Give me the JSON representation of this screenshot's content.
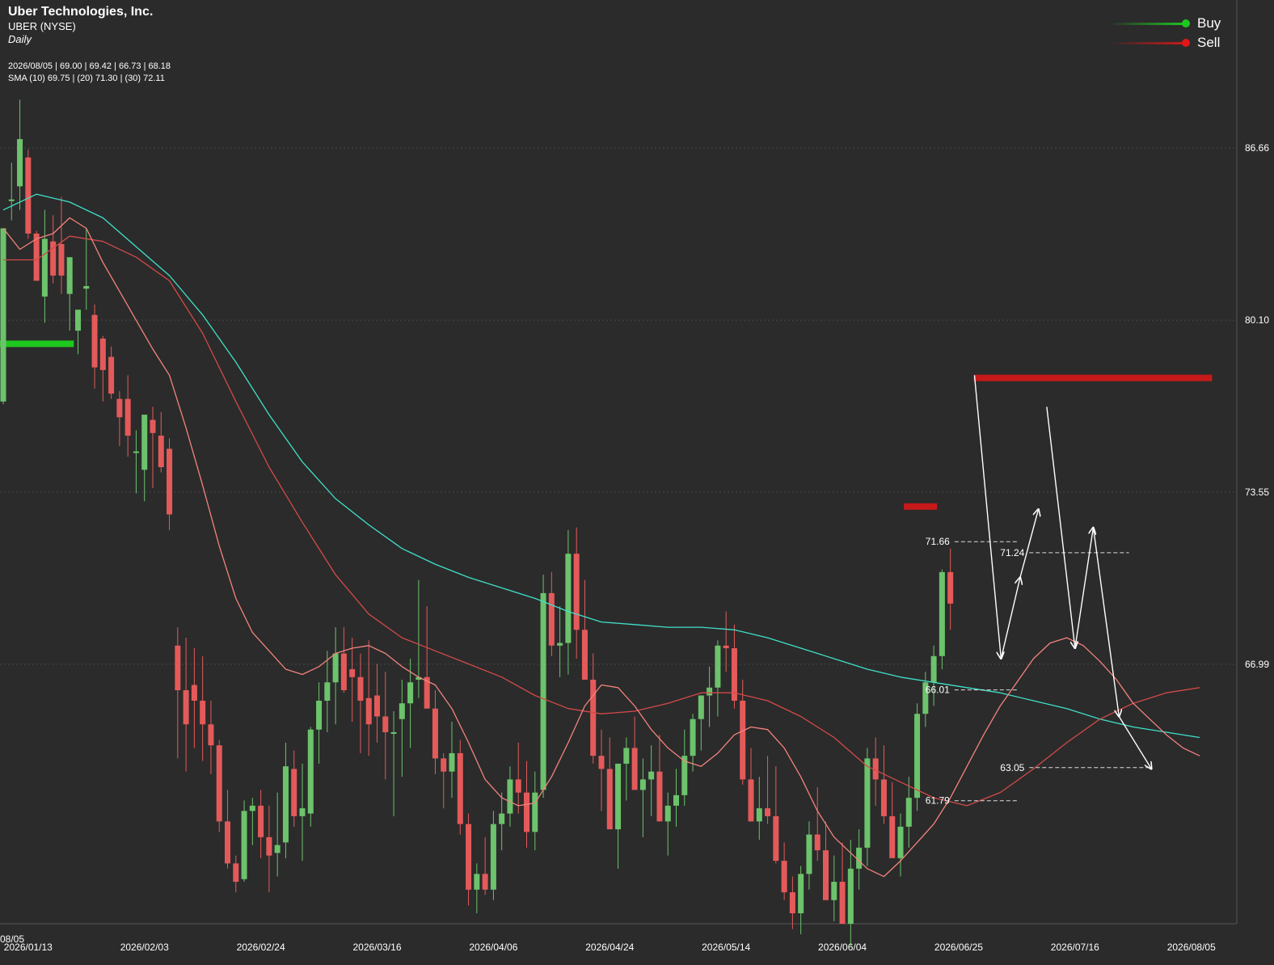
{
  "header": {
    "company": "Uber Technologies, Inc.",
    "symbol": "UBER (NYSE)",
    "period": "Daily",
    "ohlc": "2026/08/05 | 69.00 | 69.42 | 66.73 | 68.18",
    "sma": "SMA (10) 69.75 | (20) 71.30 | (30) 72.11"
  },
  "legend": {
    "buy": "Buy",
    "sell": "Sell"
  },
  "colors": {
    "background": "#2b2b2b",
    "up_candle": "#6cc36c",
    "down_candle": "#e45a5a",
    "sma10": "#f4837d",
    "sma20": "#d24a48",
    "sma30": "#40e0c8",
    "buy": "#1ec81e",
    "sell": "#d01818",
    "annotation": "#ffffff"
  },
  "chart_data": {
    "type": "candlestick",
    "y_ticks": [
      "86.66",
      "80.10",
      "73.55",
      "66.99"
    ],
    "ylim": [
      57.1,
      92.3
    ],
    "x_tick_labels": [
      "08/05",
      "2026/01/13",
      "2026/02/03",
      "2026/02/24",
      "2026/03/16",
      "2026/04/06",
      "2026/04/24",
      "2026/05/14",
      "2026/06/04",
      "2026/06/25",
      "2026/07/16",
      "2026/08/05"
    ],
    "x_tick_indices": [
      -1,
      3,
      17,
      31,
      45,
      59,
      73,
      87,
      101,
      115,
      129,
      143
    ],
    "candles": [
      {
        "o": 77.0,
        "h": 83.6,
        "l": 76.9,
        "c": 83.6
      },
      {
        "o": 84.7,
        "h": 86.1,
        "l": 83.9,
        "c": 84.7
      },
      {
        "o": 85.2,
        "h": 88.5,
        "l": 84.3,
        "c": 87.0
      },
      {
        "o": 86.3,
        "h": 86.6,
        "l": 83.2,
        "c": 83.4
      },
      {
        "o": 83.4,
        "h": 83.5,
        "l": 81.6,
        "c": 81.6
      },
      {
        "o": 81.0,
        "h": 84.3,
        "l": 80.0,
        "c": 83.2
      },
      {
        "o": 83.1,
        "h": 84.1,
        "l": 81.5,
        "c": 81.8
      },
      {
        "o": 83.0,
        "h": 84.8,
        "l": 81.1,
        "c": 81.8
      },
      {
        "o": 81.1,
        "h": 82.3,
        "l": 79.7,
        "c": 82.5
      },
      {
        "o": 79.7,
        "h": 80.3,
        "l": 78.8,
        "c": 80.5
      },
      {
        "o": 81.3,
        "h": 83.6,
        "l": 80.5,
        "c": 81.4
      },
      {
        "o": 80.3,
        "h": 80.7,
        "l": 77.5,
        "c": 78.3
      },
      {
        "o": 79.4,
        "h": 79.5,
        "l": 77.0,
        "c": 78.2
      },
      {
        "o": 78.7,
        "h": 79.1,
        "l": 77.1,
        "c": 77.3
      },
      {
        "o": 77.1,
        "h": 77.4,
        "l": 75.3,
        "c": 76.4
      },
      {
        "o": 77.1,
        "h": 78.0,
        "l": 74.9,
        "c": 75.7
      },
      {
        "o": 75.1,
        "h": 75.9,
        "l": 73.5,
        "c": 75.1
      },
      {
        "o": 74.4,
        "h": 76.4,
        "l": 73.2,
        "c": 76.5
      },
      {
        "o": 76.3,
        "h": 76.8,
        "l": 73.7,
        "c": 75.8
      },
      {
        "o": 75.7,
        "h": 76.6,
        "l": 74.3,
        "c": 74.5
      },
      {
        "o": 75.2,
        "h": 75.6,
        "l": 72.1,
        "c": 72.7
      },
      {
        "o": 67.7,
        "h": 68.4,
        "l": 63.4,
        "c": 66.0
      },
      {
        "o": 66.0,
        "h": 68.0,
        "l": 62.9,
        "c": 64.7
      },
      {
        "o": 66.2,
        "h": 67.6,
        "l": 63.8,
        "c": 65.6
      },
      {
        "o": 65.6,
        "h": 67.3,
        "l": 63.3,
        "c": 64.7
      },
      {
        "o": 64.7,
        "h": 65.6,
        "l": 62.8,
        "c": 63.9
      },
      {
        "o": 63.9,
        "h": 64.1,
        "l": 60.6,
        "c": 61.0
      },
      {
        "o": 61.0,
        "h": 62.2,
        "l": 59.2,
        "c": 59.4
      },
      {
        "o": 59.4,
        "h": 59.7,
        "l": 58.3,
        "c": 58.7
      },
      {
        "o": 58.8,
        "h": 61.8,
        "l": 58.7,
        "c": 61.4
      },
      {
        "o": 61.4,
        "h": 61.9,
        "l": 60.1,
        "c": 61.6
      },
      {
        "o": 61.6,
        "h": 62.2,
        "l": 59.6,
        "c": 60.4
      },
      {
        "o": 60.4,
        "h": 61.6,
        "l": 58.3,
        "c": 59.7
      },
      {
        "o": 59.8,
        "h": 62.1,
        "l": 58.9,
        "c": 60.1
      },
      {
        "o": 60.2,
        "h": 64.0,
        "l": 59.6,
        "c": 63.1
      },
      {
        "o": 63.0,
        "h": 63.7,
        "l": 60.8,
        "c": 61.2
      },
      {
        "o": 61.2,
        "h": 63.2,
        "l": 59.5,
        "c": 61.5
      },
      {
        "o": 61.3,
        "h": 64.6,
        "l": 60.8,
        "c": 64.5
      },
      {
        "o": 64.5,
        "h": 66.3,
        "l": 63.2,
        "c": 65.6
      },
      {
        "o": 65.6,
        "h": 67.5,
        "l": 64.4,
        "c": 66.3
      },
      {
        "o": 66.3,
        "h": 68.4,
        "l": 64.7,
        "c": 67.4
      },
      {
        "o": 67.4,
        "h": 68.4,
        "l": 65.9,
        "c": 66.0
      },
      {
        "o": 66.8,
        "h": 68.0,
        "l": 64.8,
        "c": 66.5
      },
      {
        "o": 66.5,
        "h": 67.4,
        "l": 63.6,
        "c": 65.6
      },
      {
        "o": 65.7,
        "h": 67.9,
        "l": 63.5,
        "c": 64.7
      },
      {
        "o": 65.8,
        "h": 67.0,
        "l": 64.0,
        "c": 65.0
      },
      {
        "o": 65.0,
        "h": 66.7,
        "l": 62.6,
        "c": 64.4
      },
      {
        "o": 64.4,
        "h": 65.2,
        "l": 61.2,
        "c": 64.4
      },
      {
        "o": 64.9,
        "h": 66.4,
        "l": 62.7,
        "c": 65.5
      },
      {
        "o": 65.5,
        "h": 67.2,
        "l": 63.8,
        "c": 66.3
      },
      {
        "o": 66.4,
        "h": 70.2,
        "l": 65.7,
        "c": 66.5
      },
      {
        "o": 66.5,
        "h": 69.2,
        "l": 65.6,
        "c": 65.3
      },
      {
        "o": 65.3,
        "h": 66.0,
        "l": 62.8,
        "c": 63.4
      },
      {
        "o": 63.4,
        "h": 63.6,
        "l": 61.5,
        "c": 62.9
      },
      {
        "o": 62.9,
        "h": 64.8,
        "l": 61.9,
        "c": 63.6
      },
      {
        "o": 63.6,
        "h": 64.1,
        "l": 60.5,
        "c": 60.9
      },
      {
        "o": 60.9,
        "h": 61.3,
        "l": 57.8,
        "c": 58.4
      },
      {
        "o": 58.4,
        "h": 59.4,
        "l": 57.5,
        "c": 59.0
      },
      {
        "o": 59.0,
        "h": 60.4,
        "l": 58.2,
        "c": 58.4
      },
      {
        "o": 58.4,
        "h": 61.4,
        "l": 58.0,
        "c": 60.9
      },
      {
        "o": 60.9,
        "h": 62.1,
        "l": 59.9,
        "c": 61.3
      },
      {
        "o": 61.3,
        "h": 63.1,
        "l": 60.8,
        "c": 62.6
      },
      {
        "o": 62.6,
        "h": 64.0,
        "l": 61.3,
        "c": 62.1
      },
      {
        "o": 62.1,
        "h": 63.3,
        "l": 60.0,
        "c": 60.6
      },
      {
        "o": 60.6,
        "h": 62.9,
        "l": 59.9,
        "c": 62.1
      },
      {
        "o": 62.2,
        "h": 70.4,
        "l": 61.9,
        "c": 69.7
      },
      {
        "o": 69.7,
        "h": 70.5,
        "l": 67.3,
        "c": 67.7
      },
      {
        "o": 67.7,
        "h": 69.2,
        "l": 66.5,
        "c": 67.8
      },
      {
        "o": 67.8,
        "h": 72.1,
        "l": 66.6,
        "c": 71.2
      },
      {
        "o": 71.2,
        "h": 72.2,
        "l": 67.2,
        "c": 68.3
      },
      {
        "o": 68.3,
        "h": 70.2,
        "l": 66.9,
        "c": 66.4
      },
      {
        "o": 66.4,
        "h": 67.4,
        "l": 63.2,
        "c": 63.5
      },
      {
        "o": 63.5,
        "h": 64.5,
        "l": 61.4,
        "c": 63.0
      },
      {
        "o": 63.0,
        "h": 64.2,
        "l": 61.1,
        "c": 60.7
      },
      {
        "o": 60.7,
        "h": 63.2,
        "l": 59.2,
        "c": 63.2
      },
      {
        "o": 63.2,
        "h": 64.2,
        "l": 61.8,
        "c": 63.8
      },
      {
        "o": 63.8,
        "h": 65.0,
        "l": 62.3,
        "c": 62.2
      },
      {
        "o": 62.2,
        "h": 63.4,
        "l": 60.4,
        "c": 62.6
      },
      {
        "o": 62.6,
        "h": 63.9,
        "l": 61.2,
        "c": 62.9
      },
      {
        "o": 62.9,
        "h": 64.3,
        "l": 61.8,
        "c": 61.0
      },
      {
        "o": 61.0,
        "h": 62.1,
        "l": 59.7,
        "c": 61.6
      },
      {
        "o": 61.6,
        "h": 63.0,
        "l": 60.8,
        "c": 62.0
      },
      {
        "o": 62.0,
        "h": 64.5,
        "l": 61.6,
        "c": 63.5
      },
      {
        "o": 63.5,
        "h": 65.1,
        "l": 62.9,
        "c": 64.9
      },
      {
        "o": 64.9,
        "h": 65.6,
        "l": 63.7,
        "c": 65.8
      },
      {
        "o": 65.8,
        "h": 66.9,
        "l": 64.6,
        "c": 66.1
      },
      {
        "o": 66.1,
        "h": 67.9,
        "l": 65.0,
        "c": 67.7
      },
      {
        "o": 67.7,
        "h": 69.0,
        "l": 66.7,
        "c": 67.6
      },
      {
        "o": 67.6,
        "h": 68.5,
        "l": 65.3,
        "c": 65.6
      },
      {
        "o": 65.6,
        "h": 66.4,
        "l": 62.4,
        "c": 62.6
      },
      {
        "o": 62.6,
        "h": 63.8,
        "l": 61.4,
        "c": 61.0
      },
      {
        "o": 61.0,
        "h": 62.7,
        "l": 60.3,
        "c": 61.5
      },
      {
        "o": 61.5,
        "h": 63.5,
        "l": 60.9,
        "c": 61.2
      },
      {
        "o": 61.2,
        "h": 63.1,
        "l": 59.4,
        "c": 59.5
      },
      {
        "o": 59.5,
        "h": 60.2,
        "l": 58.0,
        "c": 58.3
      },
      {
        "o": 58.3,
        "h": 58.9,
        "l": 56.9,
        "c": 57.5
      },
      {
        "o": 57.5,
        "h": 59.3,
        "l": 56.7,
        "c": 59.0
      },
      {
        "o": 59.0,
        "h": 61.0,
        "l": 58.4,
        "c": 60.5
      },
      {
        "o": 60.5,
        "h": 62.3,
        "l": 59.5,
        "c": 59.9
      },
      {
        "o": 59.9,
        "h": 61.0,
        "l": 58.4,
        "c": 58.0
      },
      {
        "o": 58.0,
        "h": 59.7,
        "l": 57.2,
        "c": 58.7
      },
      {
        "o": 58.7,
        "h": 60.2,
        "l": 57.3,
        "c": 57.1
      },
      {
        "o": 57.1,
        "h": 60.3,
        "l": 56.2,
        "c": 59.2
      },
      {
        "o": 59.2,
        "h": 60.7,
        "l": 58.4,
        "c": 60.0
      },
      {
        "o": 60.0,
        "h": 63.8,
        "l": 59.3,
        "c": 63.4
      },
      {
        "o": 63.4,
        "h": 64.2,
        "l": 61.6,
        "c": 62.6
      },
      {
        "o": 62.6,
        "h": 63.9,
        "l": 60.9,
        "c": 61.2
      },
      {
        "o": 61.2,
        "h": 62.5,
        "l": 59.8,
        "c": 59.6
      },
      {
        "o": 59.6,
        "h": 61.3,
        "l": 58.9,
        "c": 60.8
      },
      {
        "o": 60.8,
        "h": 62.7,
        "l": 60.0,
        "c": 61.9
      },
      {
        "o": 61.9,
        "h": 65.5,
        "l": 61.4,
        "c": 65.1
      },
      {
        "o": 65.1,
        "h": 66.7,
        "l": 64.6,
        "c": 66.3
      },
      {
        "o": 66.3,
        "h": 67.7,
        "l": 65.4,
        "c": 67.3
      },
      {
        "o": 67.3,
        "h": 70.6,
        "l": 66.8,
        "c": 70.5
      },
      {
        "o": 70.5,
        "h": 71.4,
        "l": 68.3,
        "c": 69.3
      }
    ],
    "candle_x_start": 4,
    "candle_x_end": 1484,
    "visible_count": 145,
    "sma10": [
      [
        0,
        83.6
      ],
      [
        2,
        82.8
      ],
      [
        4,
        83.2
      ],
      [
        6,
        83.4
      ],
      [
        8,
        84.0
      ],
      [
        10,
        83.6
      ],
      [
        12,
        82.3
      ],
      [
        14,
        81.2
      ],
      [
        16,
        80.1
      ],
      [
        18,
        79.0
      ],
      [
        20,
        78.0
      ],
      [
        22,
        76.0
      ],
      [
        24,
        73.8
      ],
      [
        26,
        71.5
      ],
      [
        28,
        69.5
      ],
      [
        30,
        68.2
      ],
      [
        32,
        67.5
      ],
      [
        34,
        66.8
      ],
      [
        36,
        66.6
      ],
      [
        38,
        66.9
      ],
      [
        40,
        67.4
      ],
      [
        42,
        67.6
      ],
      [
        44,
        67.7
      ],
      [
        46,
        67.4
      ],
      [
        48,
        66.9
      ],
      [
        50,
        66.5
      ],
      [
        52,
        66.2
      ],
      [
        54,
        65.3
      ],
      [
        56,
        64.0
      ],
      [
        58,
        62.6
      ],
      [
        60,
        61.9
      ],
      [
        62,
        61.6
      ],
      [
        64,
        61.7
      ],
      [
        66,
        62.7
      ],
      [
        68,
        64.0
      ],
      [
        70,
        65.4
      ],
      [
        72,
        66.2
      ],
      [
        74,
        66.1
      ],
      [
        76,
        65.4
      ],
      [
        78,
        64.5
      ],
      [
        80,
        63.8
      ],
      [
        82,
        63.3
      ],
      [
        84,
        63.1
      ],
      [
        86,
        63.6
      ],
      [
        88,
        64.3
      ],
      [
        90,
        64.6
      ],
      [
        92,
        64.5
      ],
      [
        94,
        63.8
      ],
      [
        96,
        62.7
      ],
      [
        98,
        61.4
      ],
      [
        100,
        60.4
      ],
      [
        102,
        59.8
      ],
      [
        104,
        59.2
      ],
      [
        106,
        58.9
      ],
      [
        108,
        59.5
      ],
      [
        110,
        60.2
      ],
      [
        112,
        60.9
      ],
      [
        114,
        61.9
      ],
      [
        116,
        63.1
      ],
      [
        118,
        64.3
      ],
      [
        120,
        65.4
      ],
      [
        122,
        66.3
      ],
      [
        124,
        67.2
      ],
      [
        126,
        67.8
      ],
      [
        128,
        68.0
      ],
      [
        130,
        67.7
      ],
      [
        132,
        67.1
      ],
      [
        134,
        66.4
      ],
      [
        136,
        65.5
      ],
      [
        138,
        64.9
      ],
      [
        140,
        64.3
      ],
      [
        142,
        63.8
      ],
      [
        144,
        63.5
      ]
    ],
    "sma20": [
      [
        0,
        82.4
      ],
      [
        4,
        82.4
      ],
      [
        8,
        83.3
      ],
      [
        12,
        83.1
      ],
      [
        16,
        82.5
      ],
      [
        20,
        81.6
      ],
      [
        24,
        79.6
      ],
      [
        28,
        77.0
      ],
      [
        32,
        74.5
      ],
      [
        36,
        72.4
      ],
      [
        40,
        70.4
      ],
      [
        44,
        68.9
      ],
      [
        48,
        68.0
      ],
      [
        52,
        67.5
      ],
      [
        56,
        67.0
      ],
      [
        60,
        66.5
      ],
      [
        64,
        65.8
      ],
      [
        68,
        65.3
      ],
      [
        72,
        65.1
      ],
      [
        76,
        65.2
      ],
      [
        80,
        65.5
      ],
      [
        84,
        65.9
      ],
      [
        88,
        65.9
      ],
      [
        92,
        65.6
      ],
      [
        96,
        65.0
      ],
      [
        100,
        64.2
      ],
      [
        104,
        63.1
      ],
      [
        108,
        62.5
      ],
      [
        112,
        61.9
      ],
      [
        116,
        61.6
      ],
      [
        120,
        62.1
      ],
      [
        124,
        63.0
      ],
      [
        128,
        64.0
      ],
      [
        132,
        64.9
      ],
      [
        136,
        65.5
      ],
      [
        140,
        65.9
      ],
      [
        144,
        66.1
      ]
    ],
    "sma30": [
      [
        0,
        84.3
      ],
      [
        4,
        84.9
      ],
      [
        8,
        84.6
      ],
      [
        12,
        84.0
      ],
      [
        16,
        82.9
      ],
      [
        20,
        81.8
      ],
      [
        24,
        80.3
      ],
      [
        28,
        78.5
      ],
      [
        32,
        76.5
      ],
      [
        36,
        74.7
      ],
      [
        40,
        73.3
      ],
      [
        44,
        72.3
      ],
      [
        48,
        71.4
      ],
      [
        52,
        70.8
      ],
      [
        56,
        70.3
      ],
      [
        60,
        69.9
      ],
      [
        64,
        69.5
      ],
      [
        68,
        69.0
      ],
      [
        72,
        68.6
      ],
      [
        76,
        68.5
      ],
      [
        80,
        68.4
      ],
      [
        84,
        68.4
      ],
      [
        88,
        68.3
      ],
      [
        92,
        68.0
      ],
      [
        96,
        67.6
      ],
      [
        100,
        67.2
      ],
      [
        104,
        66.8
      ],
      [
        108,
        66.5
      ],
      [
        112,
        66.3
      ],
      [
        116,
        66.1
      ],
      [
        120,
        65.9
      ],
      [
        124,
        65.6
      ],
      [
        128,
        65.3
      ],
      [
        132,
        64.9
      ],
      [
        136,
        64.6
      ],
      [
        140,
        64.4
      ],
      [
        144,
        64.2
      ]
    ],
    "levels": [
      {
        "label": "71.66",
        "x_from": 114.5,
        "x_to": 122.2
      },
      {
        "label": "71.24",
        "x_from": 123.5,
        "x_to": 135.5
      },
      {
        "label": "66.01",
        "x_from": 114.5,
        "x_to": 122.2
      },
      {
        "label": "63.05",
        "x_from": 123.5,
        "x_to": 138.2
      },
      {
        "label": "61.79",
        "x_from": 114.5,
        "x_to": 122.2
      }
    ],
    "sell_zones": [
      {
        "value": 77.9,
        "x_from": 116.8,
        "x_to": 145.5
      },
      {
        "value": 73.0,
        "x_from": 108.4,
        "x_to": 112.4
      }
    ],
    "buy_zones": [
      {
        "value": 79.2,
        "x_from": -0.4,
        "x_to": 8.5
      }
    ],
    "projection_paths": [
      [
        [
          116.9,
          78.0
        ],
        [
          120.1,
          67.2
        ],
        [
          122.4,
          70.3
        ],
        [
          124.6,
          72.9
        ]
      ],
      [
        [
          125.6,
          76.8
        ],
        [
          129.0,
          67.6
        ],
        [
          131.2,
          72.2
        ],
        [
          134.3,
          65.0
        ],
        [
          138.2,
          63.0
        ]
      ]
    ]
  }
}
